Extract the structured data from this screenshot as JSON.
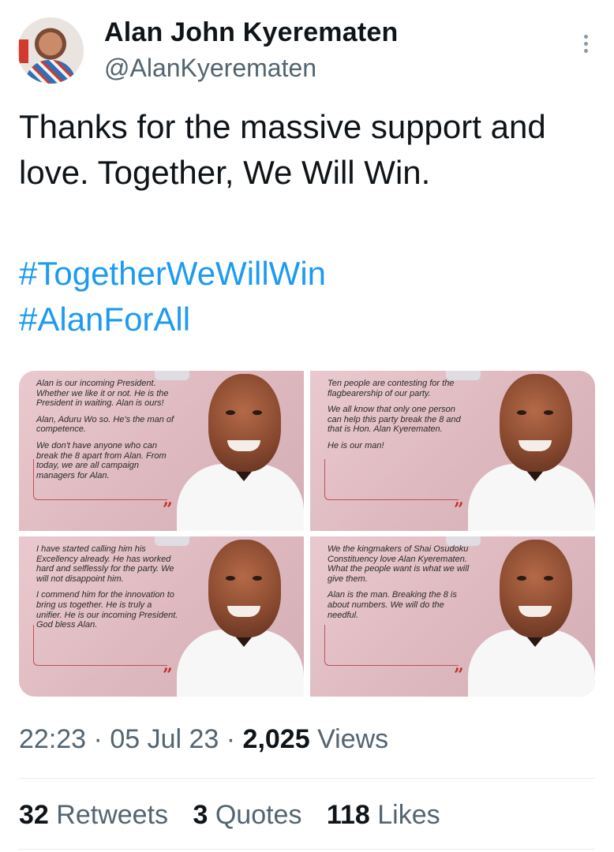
{
  "user": {
    "name": "Alan John Kyerematen",
    "handle": "@AlanKyerematen"
  },
  "tweet": {
    "text": "Thanks for the massive support and love. Together, We Will Win.",
    "hashtags": [
      "#TogetherWeWillWin",
      "#AlanForAll"
    ]
  },
  "images": [
    {
      "paragraphs": [
        "Alan is our incoming President. Whether we like it or not. He is the President in waiting. Alan is ours!",
        "Alan, Aduru Wo so. He's the man of competence.",
        "We don't have anyone who can break the 8 apart from Alan. From today, we are all campaign managers for Alan."
      ]
    },
    {
      "paragraphs": [
        "Ten people are contesting for the flagbearership of our party.",
        "We all know that only one person can help this party break the 8 and that is Hon. Alan Kyerematen.",
        "He is our man!"
      ]
    },
    {
      "paragraphs": [
        "I have started calling him his Excellency already. He has worked hard and selflessly for the party. We will not disappoint him.",
        "I commend him for the innovation to bring us together. He is truly a unifier. He is our incoming President. God bless Alan."
      ]
    },
    {
      "paragraphs": [
        "We the kingmakers of Shai Osudoku Constituency love Alan Kyerematen. What the people want is what we will give them.",
        "Alan is the man. Breaking the 8 is about numbers. We will do the needful."
      ]
    }
  ],
  "quote_mark": "”",
  "meta": {
    "time": "22:23",
    "sep": " · ",
    "date": "05 Jul 23",
    "views_count": "2,025",
    "views_label": "Views"
  },
  "stats": {
    "retweets_count": "32",
    "retweets_label": "Retweets",
    "quotes_count": "3",
    "quotes_label": "Quotes",
    "likes_count": "118",
    "likes_label": "Likes"
  },
  "colors": {
    "link": "#1d9bf0",
    "secondary_text": "#536471",
    "card_bg": "#dcb7bd",
    "accent_red": "#c0302c"
  }
}
